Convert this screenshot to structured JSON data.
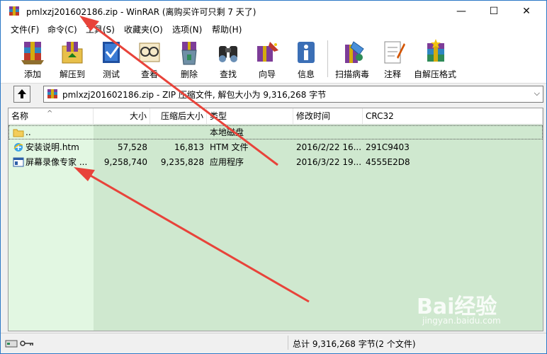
{
  "window": {
    "title": "pmlxzj201602186.zip - WinRAR (离购买许可只剩 7 天了)",
    "minimize": "—",
    "maximize": "☐",
    "close": "✕"
  },
  "menu": [
    {
      "label": "文件(F)"
    },
    {
      "label": "命令(C)"
    },
    {
      "label": "工具(S)"
    },
    {
      "label": "收藏夹(O)"
    },
    {
      "label": "选项(N)"
    },
    {
      "label": "帮助(H)"
    }
  ],
  "toolbar": [
    {
      "label": "添加",
      "icon": "add-archive-icon"
    },
    {
      "label": "解压到",
      "icon": "extract-to-icon"
    },
    {
      "label": "测试",
      "icon": "test-archive-icon"
    },
    {
      "label": "查看",
      "icon": "view-icon"
    },
    {
      "label": "删除",
      "icon": "delete-icon"
    },
    {
      "label": "查找",
      "icon": "find-icon"
    },
    {
      "label": "向导",
      "icon": "wizard-icon"
    },
    {
      "label": "信息",
      "icon": "info-icon"
    },
    {
      "label": "扫描病毒",
      "icon": "virus-scan-icon"
    },
    {
      "label": "注释",
      "icon": "comment-icon"
    },
    {
      "label": "自解压格式",
      "icon": "sfx-icon"
    }
  ],
  "address": {
    "path": "pmlxzj201602186.zip - ZIP 压缩文件, 解包大小为 9,316,268 字节",
    "chevron": "⌵"
  },
  "columns": {
    "name": "名称",
    "size": "大小",
    "packed": "压缩后大小",
    "type": "类型",
    "modified": "修改时间",
    "crc": "CRC32",
    "sort_arrow": "^"
  },
  "files": [
    {
      "name": "..",
      "size": "",
      "packed": "",
      "type": "本地磁盘",
      "modified": "",
      "crc": "",
      "icon": "folder-icon"
    },
    {
      "name": "安装说明.htm",
      "size": "57,528",
      "packed": "16,813",
      "type": "HTM 文件",
      "modified": "2016/2/22 16...",
      "crc": "291C9403",
      "icon": "ie-html-icon"
    },
    {
      "name": "屏幕录像专家 ...",
      "size": "9,258,740",
      "packed": "9,235,828",
      "type": "应用程序",
      "modified": "2016/3/22 19...",
      "crc": "4555E2D8",
      "icon": "exe-icon"
    }
  ],
  "status": {
    "summary": "总计 9,316,268 字节(2 个文件)"
  },
  "watermark": {
    "brand": "Bai经验",
    "url": "jingyan.baidu.com"
  },
  "colors": {
    "list_background": "#cfe8cf",
    "name_column": "#e2f7e2",
    "arrow": "#e8433a",
    "window_border": "#2b78c6"
  }
}
